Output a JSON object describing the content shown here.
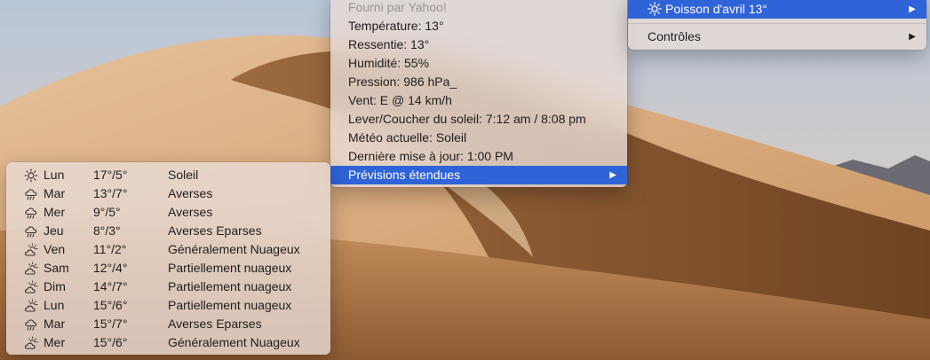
{
  "main_menu": {
    "provider": "Fourni par Yahoo!",
    "temperature": "Température: 13°",
    "feels_like": "Ressentie: 13°",
    "humidity": "Humidité: 55%",
    "pressure": "Pression: 986 hPa_",
    "wind": "Vent: E @ 14 km/h",
    "sun": "Lever/Coucher du soleil: 7:12 am / 8:08 pm",
    "current": "Météo actuelle: Soleil",
    "updated": "Dernière mise à jour: 1:00 PM",
    "extended": "Prévisions étendues"
  },
  "top_menu": {
    "location": "Poisson d'avril 13°",
    "location_icon": "sun-icon",
    "controls": "Contrôles"
  },
  "forecast": [
    {
      "icon": "sun-icon",
      "day": "Lun",
      "temp": "17°/5°",
      "cond": "Soleil"
    },
    {
      "icon": "rain-cloud-icon",
      "day": "Mar",
      "temp": "13°/7°",
      "cond": "Averses"
    },
    {
      "icon": "rain-cloud-icon",
      "day": "Mer",
      "temp": "9°/5°",
      "cond": "Averses"
    },
    {
      "icon": "rain-cloud-icon",
      "day": "Jeu",
      "temp": "8°/3°",
      "cond": "Averses Eparses"
    },
    {
      "icon": "partly-cloudy-icon",
      "day": "Ven",
      "temp": "11°/2°",
      "cond": "Généralement Nuageux"
    },
    {
      "icon": "partly-cloudy-icon",
      "day": "Sam",
      "temp": "12°/4°",
      "cond": "Partiellement nuageux"
    },
    {
      "icon": "partly-cloudy-icon",
      "day": "Dim",
      "temp": "14°/7°",
      "cond": "Partiellement nuageux"
    },
    {
      "icon": "partly-cloudy-icon",
      "day": "Lun",
      "temp": "15°/6°",
      "cond": "Partiellement nuageux"
    },
    {
      "icon": "rain-cloud-icon",
      "day": "Mar",
      "temp": "15°/7°",
      "cond": "Averses Eparses"
    },
    {
      "icon": "partly-cloudy-icon",
      "day": "Mer",
      "temp": "15°/6°",
      "cond": "Généralement Nuageux"
    }
  ],
  "colors": {
    "selection": "#2f63d8",
    "menu_bg": "#e8dcd6"
  }
}
